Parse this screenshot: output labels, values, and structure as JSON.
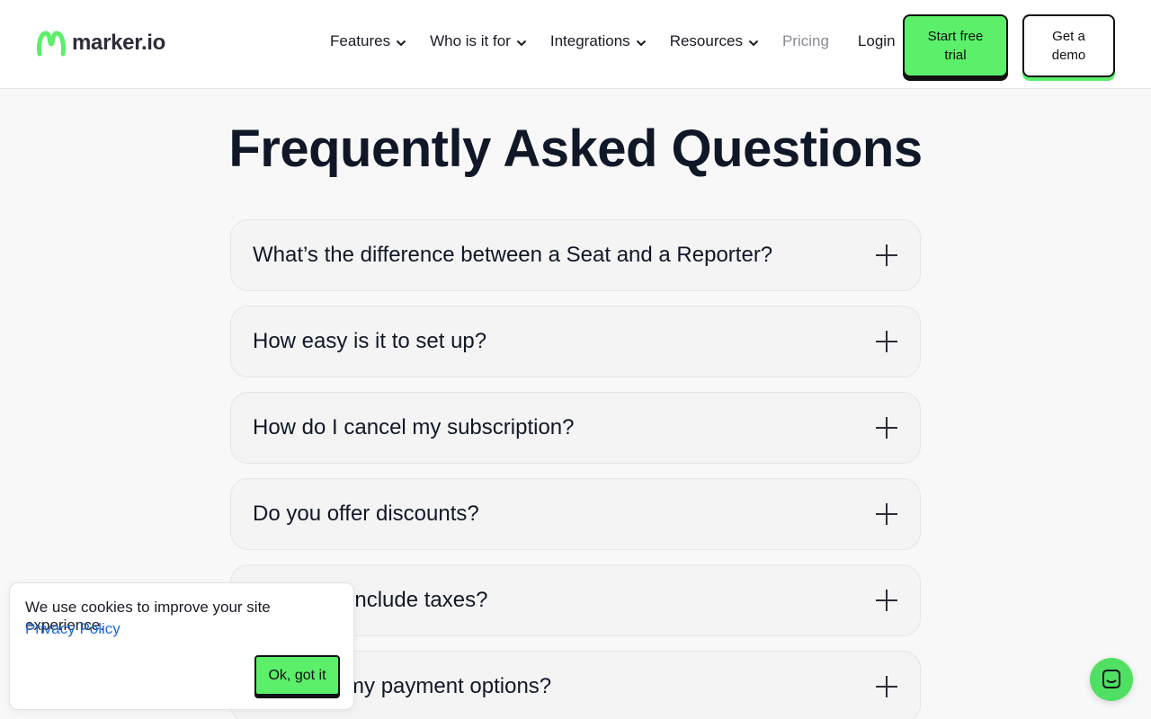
{
  "header": {
    "logo_text": "marker.io",
    "nav": [
      {
        "label": "Features",
        "has_dropdown": true
      },
      {
        "label": "Who is it for",
        "has_dropdown": true
      },
      {
        "label": "Integrations",
        "has_dropdown": true
      },
      {
        "label": "Resources",
        "has_dropdown": true
      },
      {
        "label": "Pricing",
        "has_dropdown": false
      },
      {
        "label": "Login",
        "has_dropdown": false
      }
    ],
    "trial_button": "Start free trial",
    "demo_button": "Get a demo"
  },
  "main": {
    "title": "Frequently Asked Questions",
    "faqs": [
      {
        "question": "What’s the difference between a Seat and a Reporter?"
      },
      {
        "question": "How easy is it to set up?"
      },
      {
        "question": "How do I cancel my subscription?"
      },
      {
        "question": "Do you offer discounts?"
      },
      {
        "question": "Do prices include taxes?"
      },
      {
        "question": "What are my payment options?"
      }
    ]
  },
  "cookie": {
    "text": "We use cookies to improve your site experience.",
    "link": "Privacy Policy",
    "button": "Ok, got it"
  },
  "icons": {
    "logo": "marker-logo-icon",
    "chevron": "chevron-down-icon",
    "expand": "plus-icon",
    "chat": "chat-bubble-icon"
  },
  "colors": {
    "brand_green": "#5bef6a",
    "text_dark": "#101828",
    "link_blue": "#1a6cd8"
  }
}
